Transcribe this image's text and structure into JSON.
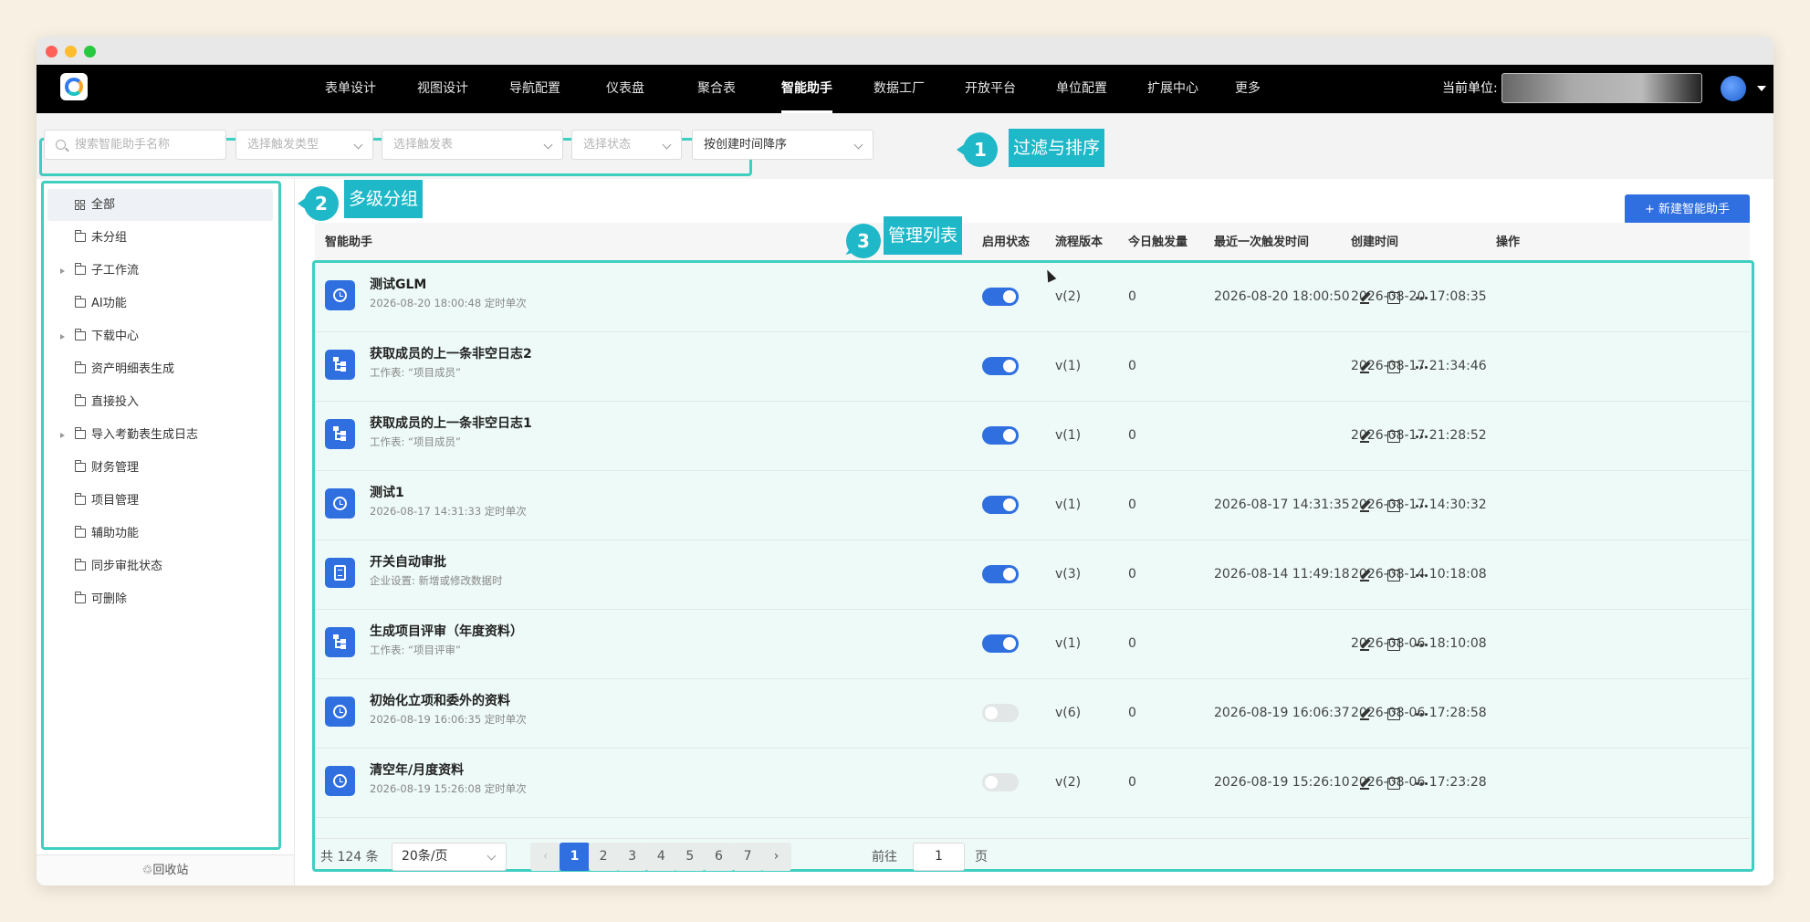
{
  "nav": {
    "items": [
      "表单设计",
      "视图设计",
      "导航配置",
      "仪表盘",
      "聚合表",
      "智能助手",
      "数据工厂",
      "开放平台",
      "单位配置",
      "扩展中心",
      "更多"
    ],
    "active_item": "智能助手",
    "unit_label": "当前单位:"
  },
  "filters": {
    "search_placeholder": "搜索智能助手名称",
    "trigger_type_placeholder": "选择触发类型",
    "trigger_table_placeholder": "选择触发表",
    "status_placeholder": "选择状态",
    "sort_value": "按创建时间降序"
  },
  "annotations": {
    "a1_num": "1",
    "a1_label": "过滤与排序",
    "a2_num": "2",
    "a2_label": "多级分组",
    "a3_num": "3",
    "a3_label": "管理列表"
  },
  "sidebar": {
    "items": [
      {
        "label": "全部",
        "icon": "grid-icon",
        "expandable": false,
        "active": true
      },
      {
        "label": "未分组",
        "icon": "folder-icon",
        "expandable": false
      },
      {
        "label": "子工作流",
        "icon": "folder-icon",
        "expandable": true
      },
      {
        "label": "AI功能",
        "icon": "folder-icon",
        "expandable": false
      },
      {
        "label": "下载中心",
        "icon": "folder-icon",
        "expandable": true
      },
      {
        "label": "资产明细表生成",
        "icon": "folder-icon",
        "expandable": false
      },
      {
        "label": "直接投入",
        "icon": "folder-icon",
        "expandable": false
      },
      {
        "label": "导入考勤表生成日志",
        "icon": "folder-icon",
        "expandable": true
      },
      {
        "label": "财务管理",
        "icon": "folder-icon",
        "expandable": false
      },
      {
        "label": "项目管理",
        "icon": "folder-icon",
        "expandable": false
      },
      {
        "label": "辅助功能",
        "icon": "folder-icon",
        "expandable": false
      },
      {
        "label": "同步审批状态",
        "icon": "folder-icon",
        "expandable": false
      },
      {
        "label": "可删除",
        "icon": "folder-icon",
        "expandable": false
      }
    ],
    "recycle_label": "回收站"
  },
  "toolbar": {
    "new_button_label": "+ 新建智能助手"
  },
  "table": {
    "columns": [
      "智能助手",
      "启用状态",
      "流程版本",
      "今日触发量",
      "最近一次触发时间",
      "创建时间",
      "操作"
    ],
    "rows": [
      {
        "name": "测试GLM",
        "sub": "2026-08-20 18:00:48 定时单次",
        "icon": "clock-icon",
        "enabled": true,
        "version": "v(2)",
        "today": "0",
        "last": "2026-08-20 18:00:50",
        "created": "2026-08-20 17:08:35"
      },
      {
        "name": "获取成员的上一条非空日志2",
        "sub": "工作表: “项目成员”",
        "icon": "worksheet-icon",
        "enabled": true,
        "version": "v(1)",
        "today": "0",
        "last": "",
        "created": "2026-08-17 21:34:46"
      },
      {
        "name": "获取成员的上一条非空日志1",
        "sub": "工作表: “项目成员”",
        "icon": "worksheet-icon",
        "enabled": true,
        "version": "v(1)",
        "today": "0",
        "last": "",
        "created": "2026-08-17 21:28:52"
      },
      {
        "name": "测试1",
        "sub": "2026-08-17 14:31:33 定时单次",
        "icon": "clock-icon",
        "enabled": true,
        "version": "v(1)",
        "today": "0",
        "last": "2026-08-17 14:31:35",
        "created": "2026-08-17 14:30:32"
      },
      {
        "name": "开关自动审批",
        "sub": "企业设置: 新增或修改数据时",
        "icon": "document-icon",
        "enabled": true,
        "version": "v(3)",
        "today": "0",
        "last": "2026-08-14 11:49:18",
        "created": "2026-08-14 10:18:08"
      },
      {
        "name": "生成项目评审（年度资料）",
        "sub": "工作表: “项目评审”",
        "icon": "worksheet-icon",
        "enabled": true,
        "version": "v(1)",
        "today": "0",
        "last": "",
        "created": "2026-08-06 18:10:08"
      },
      {
        "name": "初始化立项和委外的资料",
        "sub": "2026-08-19 16:06:35 定时单次",
        "icon": "clock-icon",
        "enabled": false,
        "version": "v(6)",
        "today": "0",
        "last": "2026-08-19 16:06:37",
        "created": "2026-08-06 17:28:58"
      },
      {
        "name": "清空年/月度资料",
        "sub": "2026-08-19 15:26:08 定时单次",
        "icon": "clock-icon",
        "enabled": false,
        "version": "v(2)",
        "today": "0",
        "last": "2026-08-19 15:26:10",
        "created": "2026-08-06 17:23:28"
      }
    ]
  },
  "pagination": {
    "total_text": "共 124 条",
    "page_size": "20条/页",
    "pages": [
      "1",
      "2",
      "3",
      "4",
      "5",
      "6",
      "7"
    ],
    "current": "1",
    "prev": "‹",
    "next": "›",
    "goto_label": "前往",
    "goto_value": "1",
    "page_suffix": "页"
  },
  "colors": {
    "accent": "#2f6fe0",
    "annotation": "#1fb8c8",
    "highlight_border": "#3ecfc0"
  }
}
